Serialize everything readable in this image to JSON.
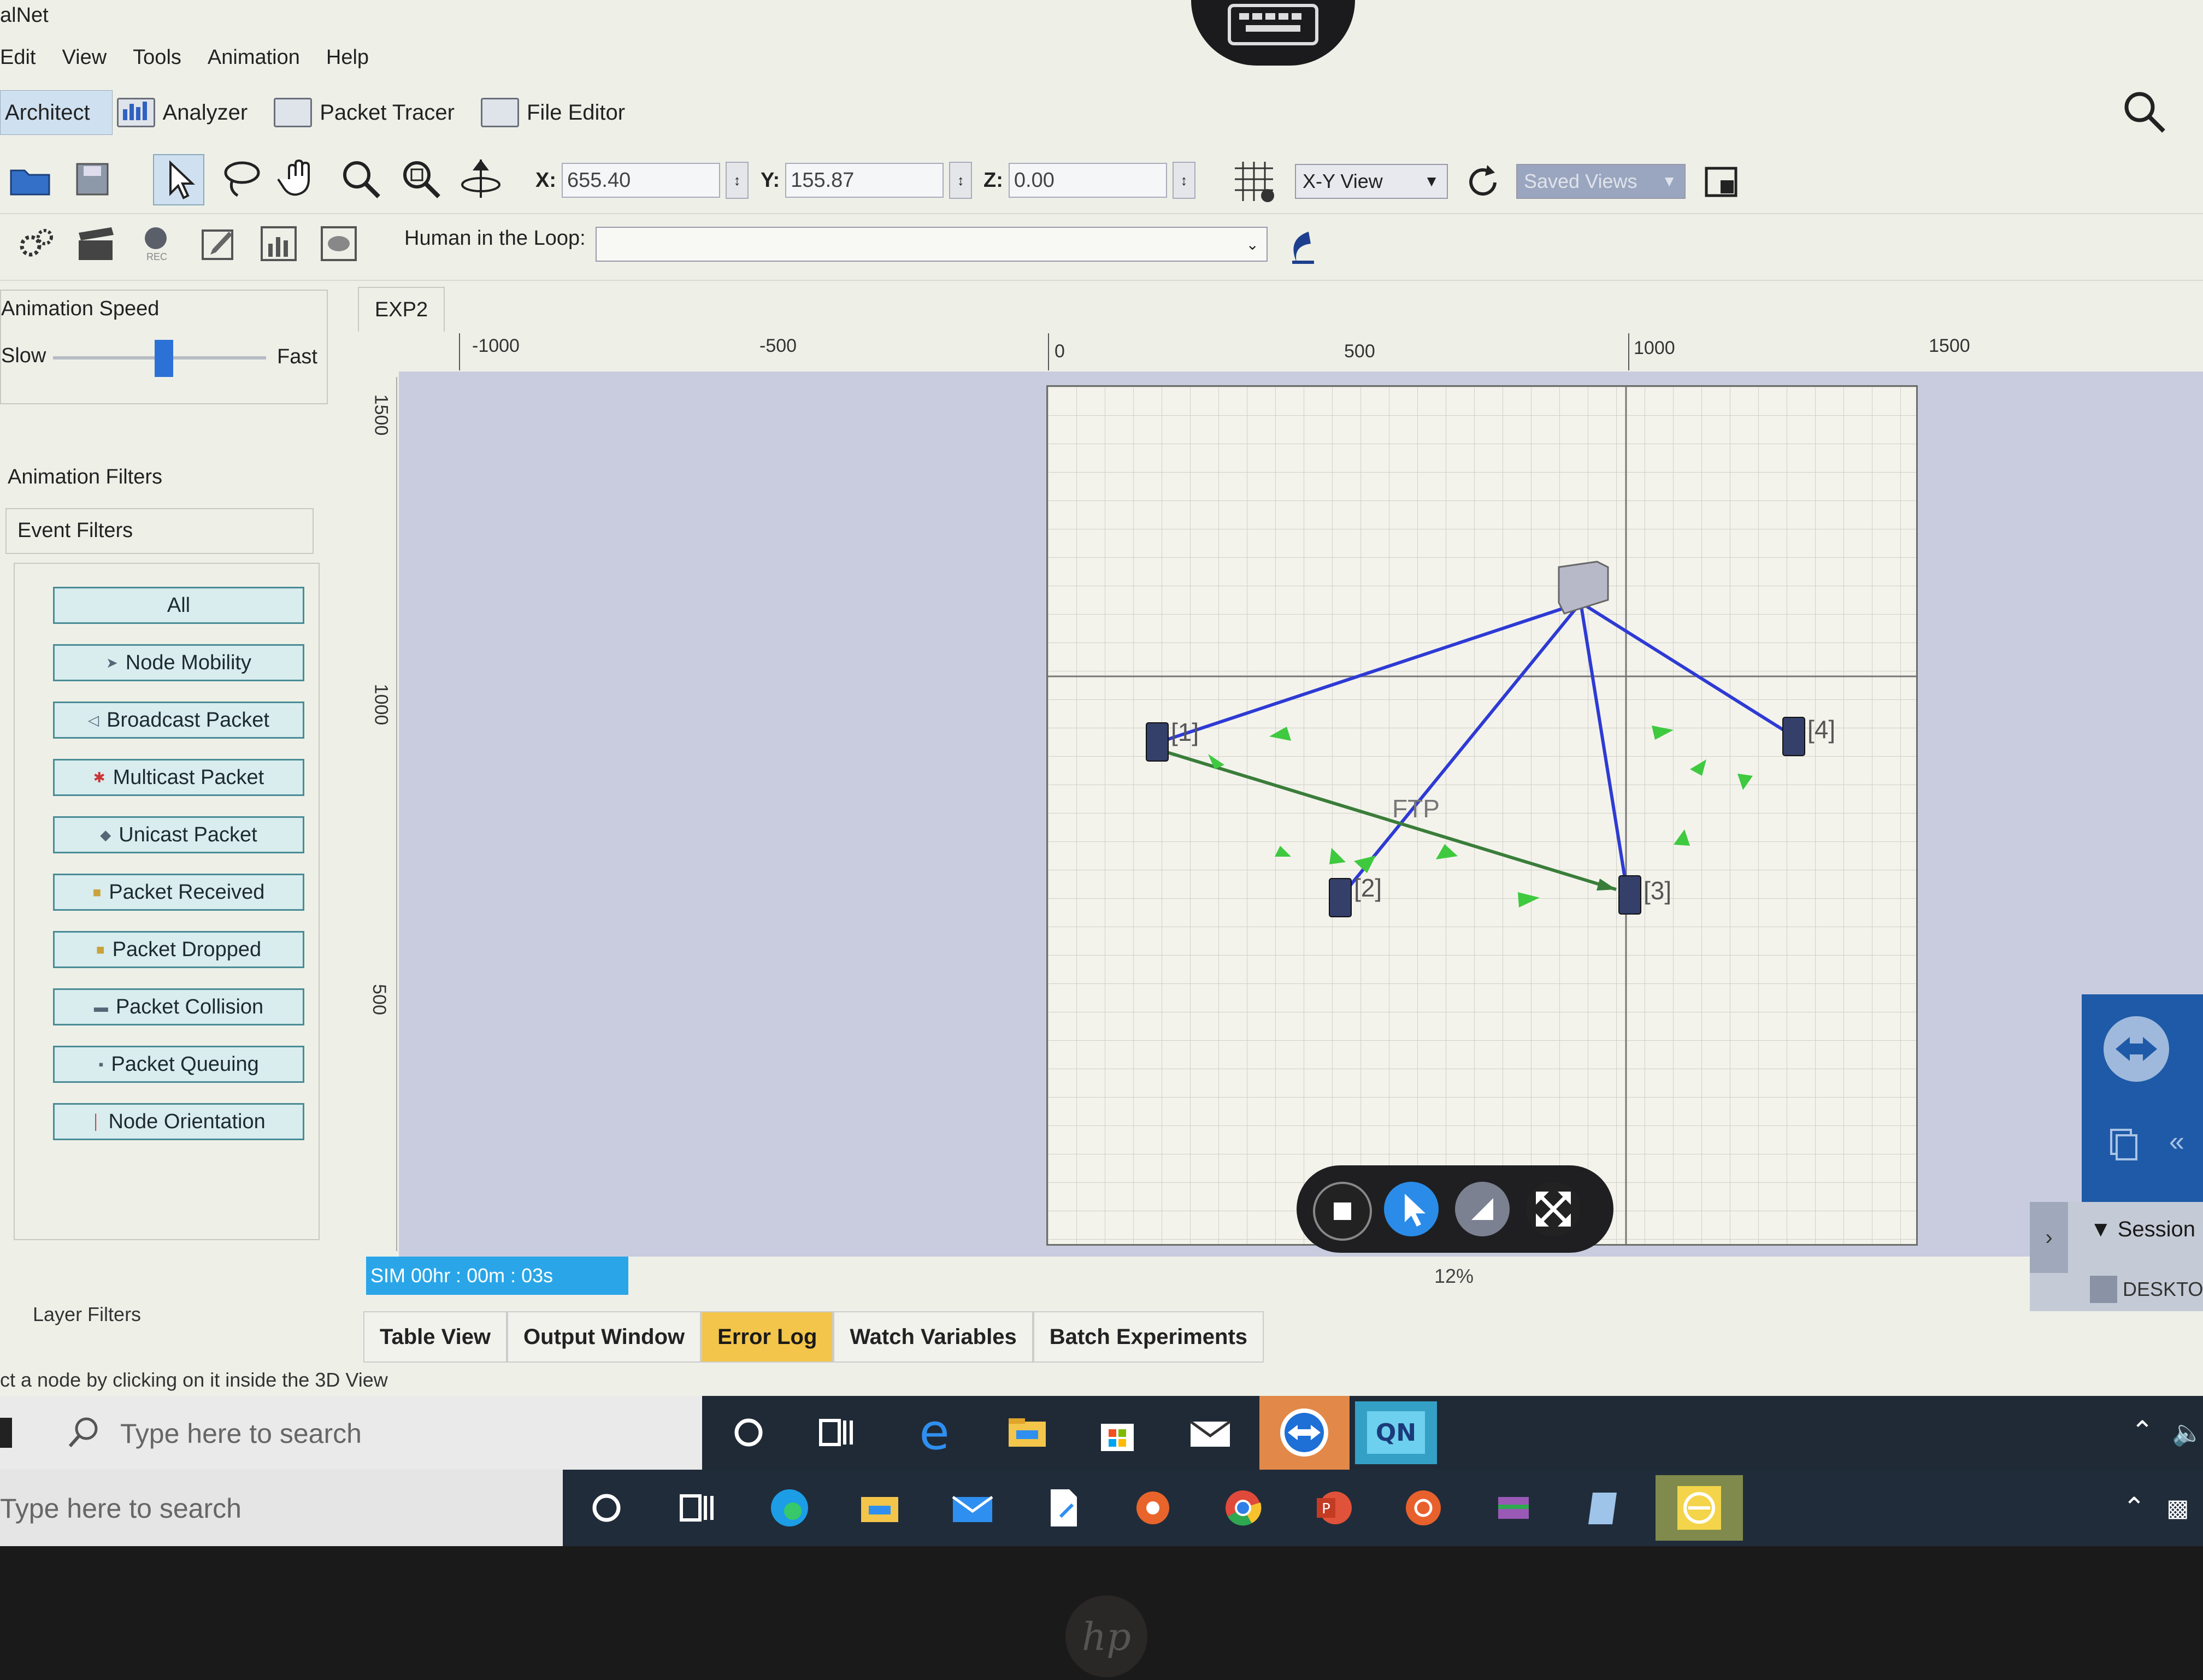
{
  "window": {
    "title": "alNet"
  },
  "menu": [
    "Edit",
    "View",
    "Tools",
    "Animation",
    "Help"
  ],
  "mode_tabs": [
    {
      "label": "Architect",
      "active": true
    },
    {
      "label": "Analyzer"
    },
    {
      "label": "Packet Tracer"
    },
    {
      "label": "File Editor"
    }
  ],
  "toolbar": {
    "x_label": "X:",
    "x_value": "655.40",
    "y_label": "Y:",
    "y_value": "155.87",
    "z_label": "Z:",
    "z_value": "0.00",
    "view_select": "X-Y View",
    "saved_views": "Saved Views",
    "hitl_label": "Human in the Loop:",
    "hitl_value": "",
    "rec_label": "REC"
  },
  "left_panel": {
    "animation_speed": "Animation Speed",
    "slow": "Slow",
    "fast": "Fast",
    "speed_level": 0.52,
    "animation_filters": "Animation Filters",
    "event_filters": "Event Filters",
    "filters": [
      "All",
      "Node Mobility",
      "Broadcast Packet",
      "Multicast Packet",
      "Unicast Packet",
      "Packet Received",
      "Packet Dropped",
      "Packet Collision",
      "Packet Queuing",
      "Node Orientation"
    ],
    "layer_filters": "Layer Filters"
  },
  "canvas": {
    "tab": "EXP2",
    "ruler_x": [
      "-1000",
      "-500",
      "0",
      "500",
      "1000",
      "1500"
    ],
    "ruler_y": [
      "1500",
      "1000",
      "500"
    ],
    "nodes": [
      "[1]",
      "[2]",
      "[3]",
      "[4]"
    ],
    "link_label": "FTP",
    "zoom": "12%"
  },
  "status": {
    "sim_time": "SIM 00hr : 00m : 03s",
    "hint": "ct a node by clicking on it inside the 3D View"
  },
  "bottom_tabs": [
    {
      "label": "Table View"
    },
    {
      "label": "Output Window"
    },
    {
      "label": "Error Log",
      "active": true
    },
    {
      "label": "Watch Variables"
    },
    {
      "label": "Batch Experiments"
    }
  ],
  "side_panel": {
    "session": "Session",
    "desktop": "DESKTO"
  },
  "taskbar_remote": {
    "search_placeholder": "Type here to search"
  },
  "taskbar_local": {
    "search_placeholder": "Type here to search"
  },
  "colors": {
    "accent": "#2aa6e8",
    "active_tab": "#f3c54a",
    "link": "#2e3ad4",
    "ftp": "#3a7d3a"
  }
}
